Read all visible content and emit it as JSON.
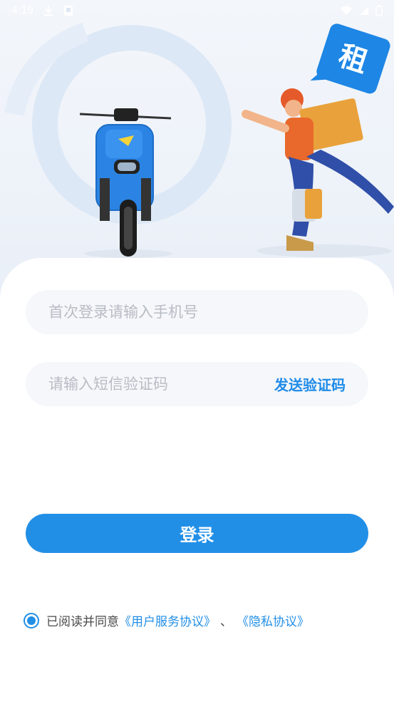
{
  "status_bar": {
    "time": "4:19"
  },
  "hero": {
    "badge_char": "租"
  },
  "form": {
    "phone_placeholder": "首次登录请输入手机号",
    "code_placeholder": "请输入短信验证码",
    "send_code_label": "发送验证码",
    "login_label": "登录"
  },
  "agreement": {
    "prefix": "已阅读并同意",
    "user_agreement": "《用户服务协议》",
    "separator": "、",
    "privacy_policy": "《隐私协议》",
    "checked": true
  },
  "colors": {
    "accent": "#228fe7",
    "link": "#228fe7",
    "placeholder": "#b8bcc4"
  }
}
